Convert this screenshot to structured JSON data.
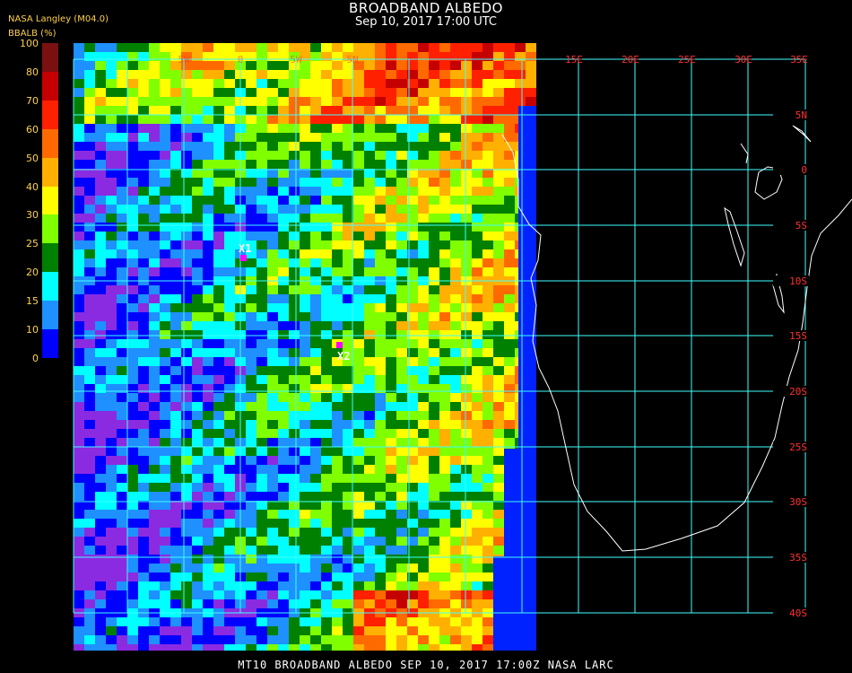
{
  "header": {
    "title": "BROADBAND ALBEDO",
    "subtitle": "Sep 10, 2017 17:00 UTC",
    "source": "NASA Langley (M04.0)",
    "units": "BBALB (%)"
  },
  "legend": {
    "ticks": [
      "100",
      "80",
      "70",
      "60",
      "50",
      "40",
      "30",
      "25",
      "20",
      "15",
      "10",
      "0"
    ],
    "colors": [
      "#7a1010",
      "#c40000",
      "#ff2000",
      "#ff6a00",
      "#ffb000",
      "#ffff00",
      "#80ff00",
      "#008000",
      "#00ffff",
      "#1e90ff",
      "#0000ff",
      "#8a2be2"
    ]
  },
  "map": {
    "lon_labels": [
      "15E",
      "20E",
      "25E",
      "30E",
      "35E"
    ],
    "lat_labels": [
      "5N",
      "0",
      "5S",
      "10S",
      "15S",
      "20S",
      "25S",
      "30S",
      "35S",
      "40S"
    ],
    "partial_labels": [
      "5W",
      "0",
      "5W",
      "5N"
    ],
    "grid_color": "#40ffff",
    "label_color": "#ff3030",
    "markers": [
      {
        "label": "X1",
        "color": "#ff00ff"
      },
      {
        "label": "X2",
        "color": "#ff00ff"
      }
    ]
  },
  "footer": "MT10  BROADBAND ALBEDO   SEP 10, 2017 17:00Z   NASA LARC"
}
